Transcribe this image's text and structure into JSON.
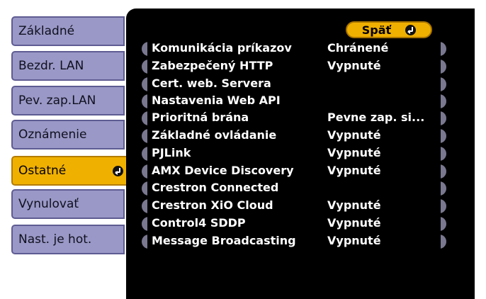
{
  "sidebar": {
    "items": [
      {
        "label": "Základné"
      },
      {
        "label": "Bezdr. LAN"
      },
      {
        "label": "Pev. zap.LAN"
      },
      {
        "label": "Oznámenie"
      },
      {
        "label": "Ostatné",
        "active": true
      },
      {
        "label": "Vynulovať"
      },
      {
        "label": "Nast. je hot."
      }
    ]
  },
  "panel": {
    "back_label": "Späť",
    "rows": [
      {
        "label": "Komunikácia príkazov",
        "value": "Chránené"
      },
      {
        "label": "Zabezpečený HTTP",
        "value": "Vypnuté"
      },
      {
        "label": "Cert. web. Servera",
        "value": ""
      },
      {
        "label": "Nastavenia Web API",
        "value": ""
      },
      {
        "label": "Prioritná brána",
        "value": "Pevne zap. si..."
      },
      {
        "label": "Základné ovládanie",
        "value": "Vypnuté"
      },
      {
        "label": "PJLink",
        "value": "Vypnuté"
      },
      {
        "label": "AMX Device Discovery",
        "value": "Vypnuté"
      },
      {
        "label": "Crestron Connected",
        "value": ""
      },
      {
        "label": "Crestron XiO Cloud",
        "value": "Vypnuté"
      },
      {
        "label": "Control4 SDDP",
        "value": "Vypnuté"
      },
      {
        "label": "Message Broadcasting",
        "value": "Vypnuté"
      }
    ]
  },
  "colors": {
    "tab": "#9a98c6",
    "tab_active": "#f0b000",
    "panel": "#000000",
    "text": "#ffffff"
  },
  "icons": {
    "enter": "enter-icon"
  }
}
